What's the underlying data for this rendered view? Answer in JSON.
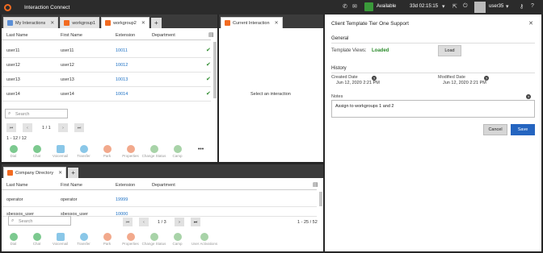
{
  "app": {
    "title": "Interaction Connect"
  },
  "topbar": {
    "status_label": "Available",
    "timer": "33d 02:15:15",
    "username": "user35",
    "icons": [
      "phone-icon",
      "mail-icon",
      "status-icon",
      "chevron-down-icon",
      "external-link-icon",
      "logout-icon",
      "key-icon",
      "help-icon"
    ]
  },
  "workgroup_panel": {
    "tabs": [
      {
        "label": "My Interactions",
        "icon": "interactions-icon",
        "color": "#5b8fd6"
      },
      {
        "label": "workgroup1",
        "icon": "queue-icon",
        "color": "#f26b21"
      },
      {
        "label": "workgroup2",
        "icon": "queue-icon",
        "color": "#f26b21"
      }
    ],
    "add_tab": "+",
    "columns": [
      "Last Name",
      "First Name",
      "Extension",
      "Department"
    ],
    "rows": [
      {
        "last": "user11",
        "first": "user11",
        "ext": "10011"
      },
      {
        "last": "user12",
        "first": "user12",
        "ext": "10012"
      },
      {
        "last": "user13",
        "first": "user13",
        "ext": "10013"
      },
      {
        "last": "user14",
        "first": "user14",
        "ext": "10014"
      }
    ],
    "search_placeholder": "Search",
    "page": "1 / 1",
    "count": "1 - 12 / 12",
    "actions": [
      "Dial",
      "Chat",
      "Voicemail",
      "Transfer",
      "Park",
      "Properties",
      "Change Status",
      "Camp"
    ],
    "more": "•••"
  },
  "current_panel": {
    "tab": "Current Interaction",
    "empty_text": "Select an interaction"
  },
  "directory_panel": {
    "tab": "Company Directory",
    "add_tab": "+",
    "columns": [
      "Last Name",
      "First Name",
      "Extension",
      "Department"
    ],
    "rows": [
      {
        "last": "operator",
        "first": "operator",
        "ext": "19999"
      },
      {
        "last": "sbessos_user",
        "first": "sbessos_user",
        "ext": "10000"
      }
    ],
    "search_placeholder": "Search",
    "page": "1 / 3",
    "count": "1 - 25 / 52",
    "actions": [
      "Dial",
      "Chat",
      "Voicemail",
      "Transfer",
      "Park",
      "Properties",
      "Change Status",
      "Camp",
      "User Activations"
    ]
  },
  "details": {
    "title": "Client Template Tier One Support",
    "general_label": "General",
    "template_views_label": "Template Views:",
    "template_views_value": "Loaded",
    "load_button": "Load",
    "history_label": "History",
    "created_label": "Created Date",
    "created_value": "Jun 12, 2020 2:21 PM",
    "modified_label": "Modified Date",
    "modified_value": "Jun 12, 2020 2:21 PM",
    "notes_label": "Notes",
    "notes_value": "Assign to workgroups 1 and 2",
    "cancel_button": "Cancel",
    "save_button": "Save"
  },
  "colors": {
    "accent": "#2565c0",
    "brand": "#f26b21",
    "link": "#1a6fc4",
    "check": "#2a8a2a",
    "available": "#3a9a3a"
  }
}
